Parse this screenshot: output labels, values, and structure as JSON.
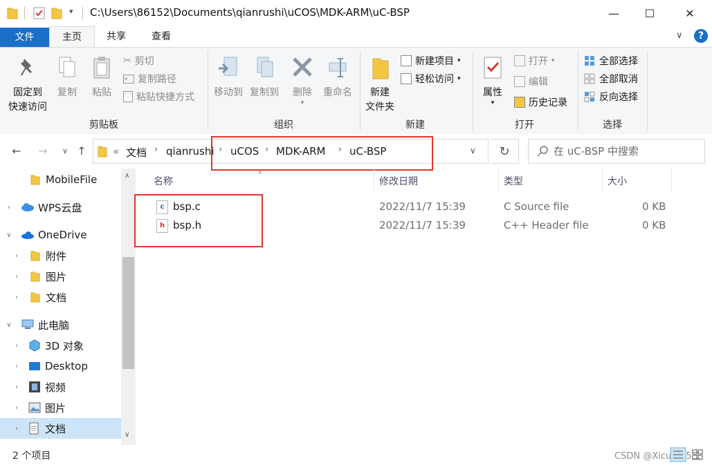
{
  "titlebar": {
    "path": "C:\\Users\\86152\\Documents\\qianrushi\\uCOS\\MDK-ARM\\uC-BSP",
    "minimize": "—",
    "maximize": "☐",
    "close": "✕"
  },
  "tabs": [
    {
      "label": "文件"
    },
    {
      "label": "主页"
    },
    {
      "label": "共享"
    },
    {
      "label": "查看"
    }
  ],
  "ribbon": {
    "clipboard": {
      "group": "剪贴板",
      "pin_line1": "固定到",
      "pin_line2": "快速访问",
      "copy": "复制",
      "paste": "粘贴",
      "cut": "剪切",
      "copy_path": "复制路径",
      "paste_shortcut": "粘贴快捷方式"
    },
    "organize": {
      "group": "组织",
      "move_to": "移动到",
      "copy_to": "复制到",
      "delete": "删除",
      "rename": "重命名"
    },
    "new": {
      "group": "新建",
      "new_folder_line1": "新建",
      "new_folder_line2": "文件夹",
      "new_item": "新建项目",
      "easy_access": "轻松访问"
    },
    "open": {
      "group": "打开",
      "properties": "属性",
      "open": "打开",
      "edit": "编辑",
      "history": "历史记录"
    },
    "select": {
      "group": "选择",
      "select_all": "全部选择",
      "select_none": "全部取消",
      "invert": "反向选择"
    }
  },
  "address": {
    "overflow": "«",
    "crumbs": [
      "文档",
      "qianrushi",
      "uCOS",
      "MDK-ARM",
      "uC-BSP"
    ],
    "search_placeholder": "在 uC-BSP 中搜索"
  },
  "nav": {
    "items": [
      {
        "label": "MobileFile"
      },
      {
        "label": "WPS云盘"
      },
      {
        "label": "OneDrive"
      },
      {
        "label": "附件"
      },
      {
        "label": "图片"
      },
      {
        "label": "文档"
      },
      {
        "label": "此电脑"
      },
      {
        "label": "3D 对象"
      },
      {
        "label": "Desktop"
      },
      {
        "label": "视频"
      },
      {
        "label": "图片"
      },
      {
        "label": "文档"
      }
    ]
  },
  "columns": {
    "name": "名称",
    "date": "修改日期",
    "type": "类型",
    "size": "大小"
  },
  "files": [
    {
      "name": "bsp.c",
      "date": "2022/11/7 15:39",
      "type": "C Source file",
      "size": "0 KB",
      "badge": "c"
    },
    {
      "name": "bsp.h",
      "date": "2022/11/7 15:39",
      "type": "C++ Header file",
      "size": "0 KB",
      "badge": "h"
    }
  ],
  "status": {
    "count": "2 个项目",
    "watermark": "CSDN @Xicun于5三"
  },
  "colors": {
    "accent": "#1a6fc9",
    "highlight": "#e0342b",
    "selected": "#cce4f7",
    "folder": "#f2c744"
  }
}
